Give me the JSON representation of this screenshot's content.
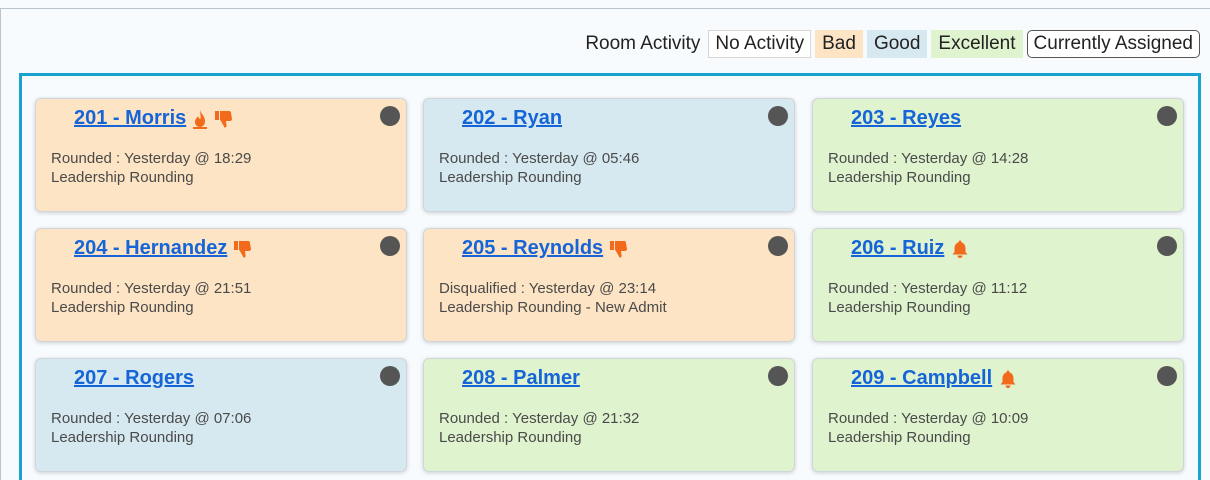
{
  "legend": {
    "title": "Room Activity",
    "items": [
      {
        "label": "No Activity",
        "kind": "none"
      },
      {
        "label": "Bad",
        "kind": "bad"
      },
      {
        "label": "Good",
        "kind": "good"
      },
      {
        "label": "Excellent",
        "kind": "excellent"
      },
      {
        "label": "Currently Assigned",
        "kind": "assigned"
      }
    ]
  },
  "colors": {
    "bad": "#fde4c4",
    "good": "#d6e9f0",
    "excellent": "#dff3cf",
    "link": "#1565d8",
    "frame": "#1aa3d1",
    "icon_orange": "#f26a1b",
    "status_dot": "#555555"
  },
  "rooms": [
    {
      "title": "201 - Morris",
      "activity": "bad",
      "icons": [
        "fire-icon",
        "thumbs-down-icon"
      ],
      "line1": "Rounded : Yesterday @ 18:29",
      "line2": "Leadership Rounding"
    },
    {
      "title": "202 - Ryan",
      "activity": "good",
      "icons": [],
      "line1": "Rounded : Yesterday @ 05:46",
      "line2": "Leadership Rounding"
    },
    {
      "title": "203 - Reyes",
      "activity": "excellent",
      "icons": [],
      "line1": "Rounded : Yesterday @ 14:28",
      "line2": "Leadership Rounding"
    },
    {
      "title": "204 - Hernandez",
      "activity": "bad",
      "icons": [
        "thumbs-down-icon"
      ],
      "line1": "Rounded : Yesterday @ 21:51",
      "line2": "Leadership Rounding"
    },
    {
      "title": "205 - Reynolds",
      "activity": "bad",
      "icons": [
        "thumbs-down-icon"
      ],
      "line1": "Disqualified : Yesterday @ 23:14",
      "line2": "Leadership Rounding - New Admit"
    },
    {
      "title": "206 - Ruiz",
      "activity": "excellent",
      "icons": [
        "bell-icon"
      ],
      "line1": "Rounded : Yesterday @ 11:12",
      "line2": "Leadership Rounding"
    },
    {
      "title": "207 - Rogers",
      "activity": "good",
      "icons": [],
      "line1": "Rounded : Yesterday @ 07:06",
      "line2": "Leadership Rounding"
    },
    {
      "title": "208 - Palmer",
      "activity": "excellent",
      "icons": [],
      "line1": "Rounded : Yesterday @ 21:32",
      "line2": "Leadership Rounding"
    },
    {
      "title": "209 - Campbell",
      "activity": "excellent",
      "icons": [
        "bell-icon"
      ],
      "line1": "Rounded : Yesterday @ 10:09",
      "line2": "Leadership Rounding"
    }
  ]
}
